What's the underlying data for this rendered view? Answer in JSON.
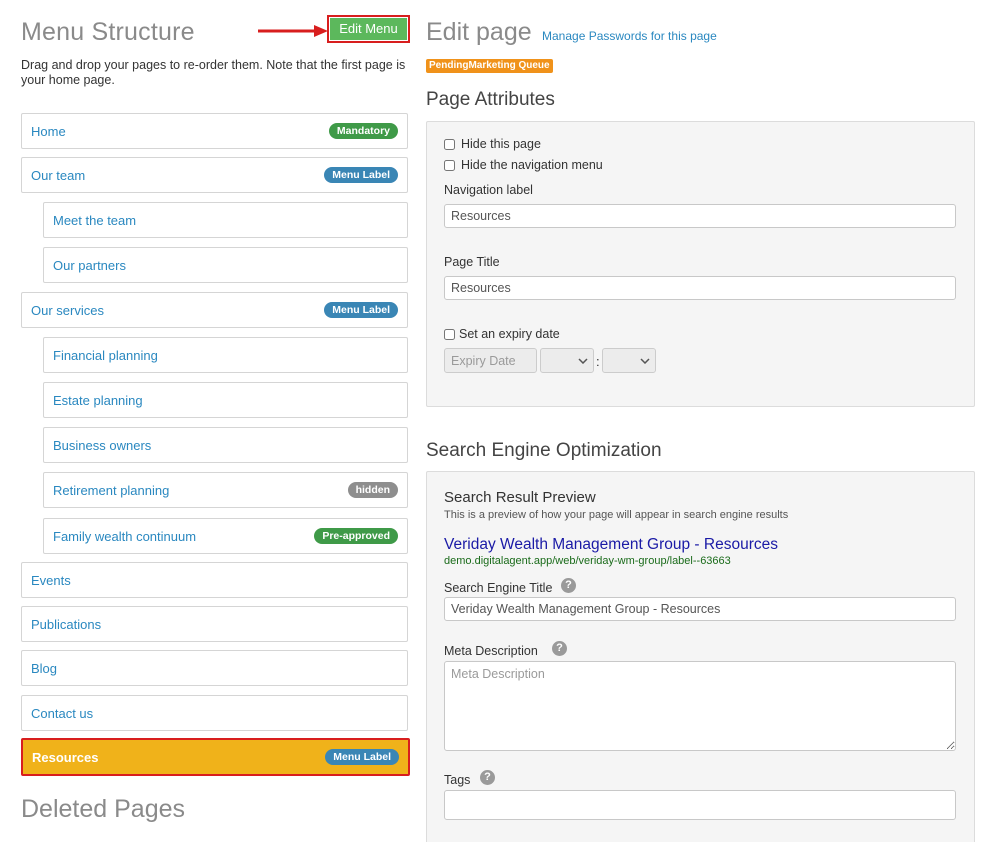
{
  "left": {
    "menu_title": "Menu Structure",
    "edit_menu_label": "Edit Menu",
    "description": "Drag and drop your pages to re-order them. Note that the first page is your home page.",
    "deleted_title": "Deleted Pages",
    "items": [
      {
        "label": "Home",
        "badge": "Mandatory"
      },
      {
        "label": "Our team",
        "badge": "Menu Label"
      },
      {
        "label": "Meet the team",
        "badge": ""
      },
      {
        "label": "Our partners",
        "badge": ""
      },
      {
        "label": "Our services",
        "badge": "Menu Label"
      },
      {
        "label": "Financial planning",
        "badge": ""
      },
      {
        "label": "Estate planning",
        "badge": ""
      },
      {
        "label": "Business owners",
        "badge": ""
      },
      {
        "label": "Retirement planning",
        "badge": "hidden"
      },
      {
        "label": "Family wealth continuum",
        "badge": "Pre-approved"
      },
      {
        "label": "Events",
        "badge": ""
      },
      {
        "label": "Publications",
        "badge": ""
      },
      {
        "label": "Blog",
        "badge": ""
      },
      {
        "label": "Contact us",
        "badge": ""
      },
      {
        "label": "Resources",
        "badge": "Menu Label"
      }
    ]
  },
  "right": {
    "edit_title": "Edit page",
    "manage_passwords": "Manage Passwords for this page",
    "status_tag": "PendingMarketing Queue",
    "attributes_title": "Page Attributes",
    "hide_page": "Hide this page",
    "hide_nav": "Hide the navigation menu",
    "nav_label": "Navigation label",
    "nav_value": "Resources",
    "page_title_label": "Page Title",
    "page_title_value": "Resources",
    "expiry_label": "Set an expiry date",
    "expiry_placeholder": "Expiry Date",
    "expiry_colon": ":",
    "seo_title": "Search Engine Optimization",
    "srp_title": "Search Result Preview",
    "srp_desc": "This is a preview of how your page will appear in search engine results",
    "srp_link": "Veriday Wealth Management Group - Resources",
    "srp_url": "demo.digitalagent.app/web/veriday-wm-group/label--63663",
    "se_title_label": "Search Engine Title",
    "se_title_value": "Veriday Wealth Management Group - Resources",
    "meta_label": "Meta Description",
    "meta_placeholder": "Meta Description",
    "tags_label": "Tags",
    "tags_value": "",
    "help_glyph": "?"
  },
  "colors": {
    "accent_link": "#2a88c0",
    "active_item": "#f0b21a",
    "highlight_border": "#d81e1e",
    "edit_button": "#5cb85c",
    "status_tag": "#f0921a"
  }
}
